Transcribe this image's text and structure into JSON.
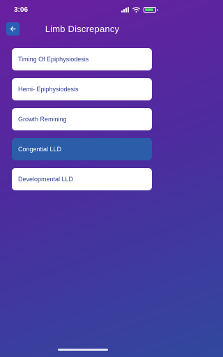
{
  "status_bar": {
    "time": "3:06"
  },
  "header": {
    "title": "Limb Discrepancy"
  },
  "menu": {
    "items": [
      {
        "label": "Timing Of Epiphysiodesis",
        "active": false
      },
      {
        "label": "Hemi- Epiphysiodesis",
        "active": false
      },
      {
        "label": "Growth Remining",
        "active": false
      },
      {
        "label": "Congential LLD",
        "active": true
      },
      {
        "label": "Developmental LLD",
        "active": false
      }
    ]
  },
  "colors": {
    "background_top": "#6a1fa0",
    "background_bottom": "#31489e",
    "accent": "#2b5da8",
    "item_text": "#2f3d8f"
  }
}
